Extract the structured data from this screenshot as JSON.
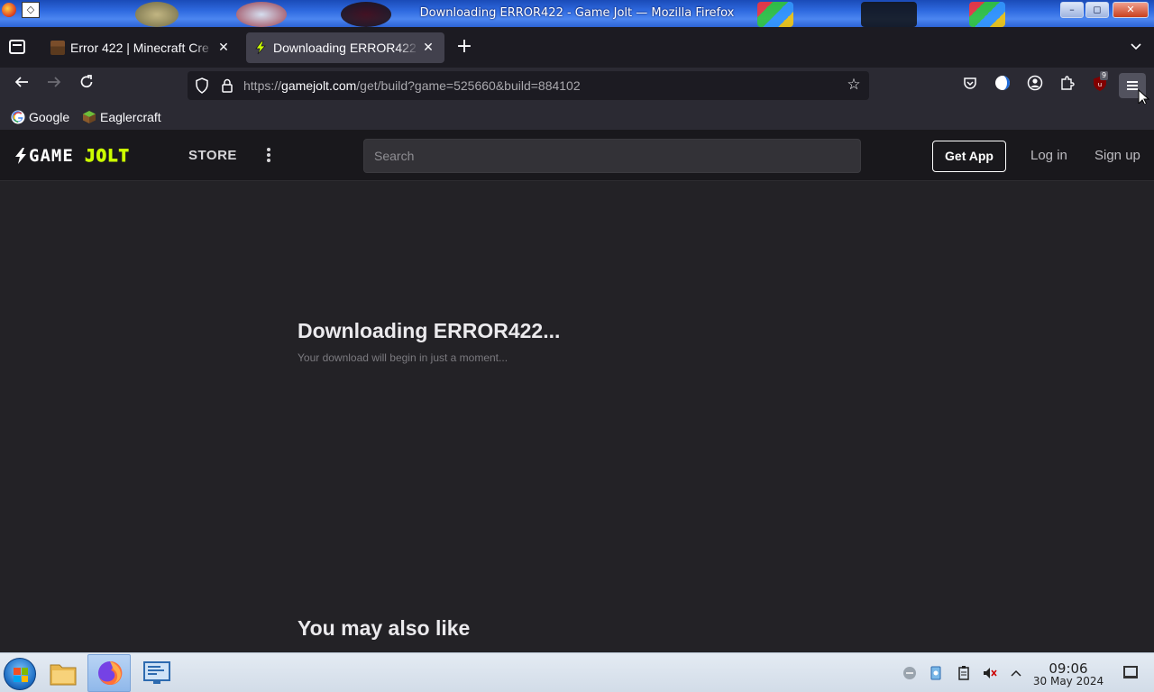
{
  "window": {
    "title": "Downloading ERROR422 - Game Jolt — Mozilla Firefox",
    "controls": {
      "minimize": "–",
      "maximize": "◻",
      "close": "✕"
    }
  },
  "tabs": [
    {
      "title": "Error 422 | Minecraft Cre",
      "active": false,
      "close": "✕"
    },
    {
      "title": "Downloading ERROR422",
      "active": true,
      "close": "✕"
    }
  ],
  "newtab_label": "+",
  "navbar": {
    "url_scheme": "https://",
    "url_host": "gamejolt.com",
    "url_path": "/get/build?game=525660&build=884102",
    "notification_count": "9"
  },
  "bookmarks": [
    {
      "label": "Google",
      "icon": "google-icon"
    },
    {
      "label": "Eaglercraft",
      "icon": "eaglercraft-icon"
    }
  ],
  "site": {
    "logo_game": "GAME",
    "logo_jolt": "JOLT",
    "store_label": "STORE",
    "search_placeholder": "Search",
    "get_app_label": "Get App",
    "login_label": "Log in",
    "signup_label": "Sign up"
  },
  "page": {
    "title": "Downloading ERROR422...",
    "subtitle": "Your download will begin in just a moment...",
    "also_like": "You may also like"
  },
  "taskbar": {
    "time": "09:06",
    "date": "30 May 2024"
  },
  "colors": {
    "brand_accent": "#ccff00",
    "page_background": "#232226",
    "header_background": "#19181c"
  }
}
